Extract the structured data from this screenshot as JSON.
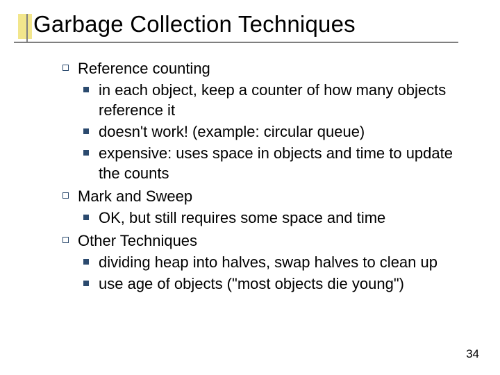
{
  "slide": {
    "title": "Garbage Collection Techniques",
    "page_number": "34",
    "sections": [
      {
        "heading": "Reference counting",
        "items": [
          "in each object, keep a counter of how many objects reference it",
          "doesn't work! (example: circular queue)",
          "expensive: uses space in objects and time to update the counts"
        ]
      },
      {
        "heading": "Mark and Sweep",
        "items": [
          "OK, but still requires some space and time"
        ]
      },
      {
        "heading": "Other Techniques",
        "items": [
          "dividing heap into halves, swap halves to clean up",
          "use age of objects (\"most objects die young\")"
        ]
      }
    ]
  }
}
